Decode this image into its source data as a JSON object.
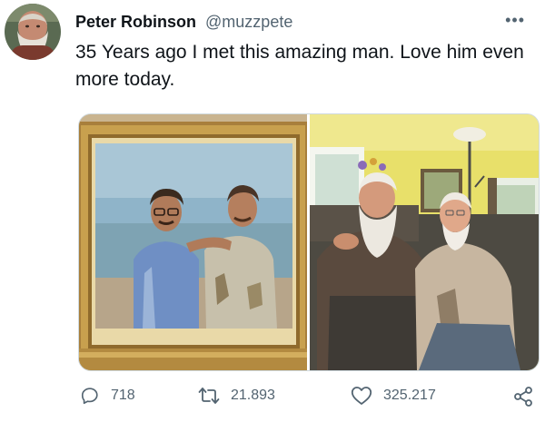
{
  "author": {
    "display_name": "Peter Robinson",
    "handle": "@muzzpete"
  },
  "tweet": {
    "text": "35 Years ago I met this amazing man. Love him even more today."
  },
  "menu": {
    "icon": "more-dots-icon",
    "label": "•••"
  },
  "actions": {
    "replies": "718",
    "retweets": "21.893",
    "likes": "325.217"
  },
  "colors": {
    "text": "#0f1419",
    "secondary": "#536471",
    "border": "#cfd9de"
  }
}
